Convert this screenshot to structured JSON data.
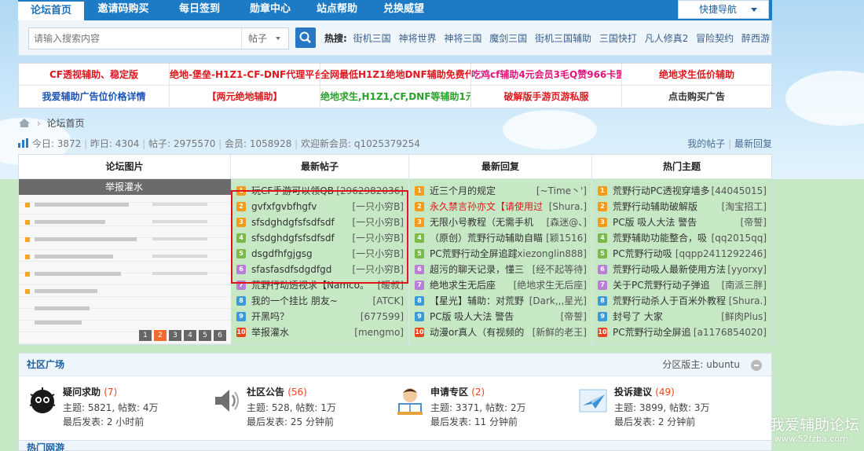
{
  "nav": {
    "items": [
      "论坛首页",
      "邀请码购买",
      "每日签到",
      "勋章中心",
      "站点帮助",
      "兑换威望"
    ],
    "quick_nav": "快捷导航"
  },
  "search": {
    "placeholder": "请输入搜索内容",
    "scope": "帖子",
    "hot_label": "热搜:",
    "hot_terms": [
      "街机三国",
      "神将世界",
      "神将三国",
      "魔剑三国",
      "街机三国辅助",
      "三国快打",
      "凡人修真2",
      "冒险契约",
      "醉西游"
    ]
  },
  "ads": [
    {
      "text": "CF透视辅助、稳定版",
      "color": "#e0161e"
    },
    {
      "text": "绝地-堡垒-H1Z1-CF-DNF代理平台",
      "color": "#e0161e"
    },
    {
      "text": "全网最低H1Z1绝地DNF辅助免费代",
      "color": "#e0161e"
    },
    {
      "text": "吃鸡cf辅助4元会员3毛Q赞966卡盟",
      "color": "#e0167c"
    },
    {
      "text": "绝地求生低价辅助",
      "color": "#e0161e"
    },
    {
      "text": "我爱辅助广告位价格详情",
      "color": "#1a52b8"
    },
    {
      "text": "【两元绝地辅助】",
      "color": "#e0161e"
    },
    {
      "text": "绝地求生,H1Z1,CF,DNF等辅助1元",
      "color": "#2aa12a"
    },
    {
      "text": "破解版手游页游私服",
      "color": "#e0161e"
    },
    {
      "text": "点击购买广告",
      "color": "#333333"
    }
  ],
  "breadcrumb": {
    "home": "论坛首页"
  },
  "stats": {
    "today_label": "今日:",
    "today": "3872",
    "yesterday_label": "昨日:",
    "yesterday": "4304",
    "posts_label": "帖子:",
    "posts": "2975570",
    "members_label": "会员:",
    "members": "1058928",
    "welcome": "欢迎新会员: q1025379254",
    "my_posts": "我的帖子",
    "latest_reply": "最新回复"
  },
  "columns": {
    "pictures": {
      "title": "论坛图片",
      "caption": "举报灌水",
      "pages": [
        "1",
        "2",
        "3",
        "4",
        "5",
        "6"
      ],
      "active_page": "2"
    },
    "new_posts": {
      "title": "最新帖子",
      "rows": [
        {
          "t": "玩CF手游可以领QB",
          "a": "[2962982036]"
        },
        {
          "t": "gvfxfgvbfhgfv",
          "a": "[一只小穷B]"
        },
        {
          "t": "sfsdghdgfsfsdfsdf",
          "a": "[一只小穷B]"
        },
        {
          "t": "sfsdghdgfsfsdfsdf",
          "a": "[一只小穷B]"
        },
        {
          "t": "dsgdfhfgjgsg",
          "a": "[一只小穷B]"
        },
        {
          "t": "sfasfasdfsdgdfgd",
          "a": "[一只小穷B]"
        },
        {
          "t": "荒野行动透视求【Namco。",
          "a": "[暖叔]"
        },
        {
          "t": "我的一个挂比 朋友~",
          "a": "[ATCK]"
        },
        {
          "t": "开黑吗？",
          "a": "[677599]"
        },
        {
          "t": "举报灌水",
          "a": "[mengmo]"
        }
      ]
    },
    "new_replies": {
      "title": "最新回复",
      "rows": [
        {
          "t": "近三个月的规定",
          "a": "[~Time丶']"
        },
        {
          "t": "永久禁言孙亦文【请使用过",
          "a": "[Shura.]",
          "red": true
        },
        {
          "t": "无限小号教程（无需手机",
          "a": "[森迷@、]"
        },
        {
          "t": "（原创）荒野行动辅助自瞄",
          "a": "[颖1516]"
        },
        {
          "t": "PC荒野行动全屏追踪",
          "a": "[xiezonglin888]"
        },
        {
          "t": "超污的聊天记录，懂三",
          "a": "[经不起等待]"
        },
        {
          "t": "绝地求生无后座",
          "a": "[绝地求生无后座]"
        },
        {
          "t": "【星光】辅助：对荒野",
          "a": "[Dark,,,星光]"
        },
        {
          "t": "PC版 吸人大法 警告",
          "a": "[帝誓]"
        },
        {
          "t": "动漫or真人（有视频的",
          "a": "[新鲜的老王]"
        }
      ]
    },
    "hot_topics": {
      "title": "热门主题",
      "rows": [
        {
          "t": "荒野行动PC透视穿墙多",
          "a": "[44045015]"
        },
        {
          "t": "荒野行动辅助破解版",
          "a": "[淘宝招工]"
        },
        {
          "t": "PC版 吸人大法 警告",
          "a": "[帝誓]"
        },
        {
          "t": "荒野辅助功能整合，吸",
          "a": "[qq2015qq]"
        },
        {
          "t": "PC荒野行动吸",
          "a": "[qqpp2411292246]"
        },
        {
          "t": "荒野行动吸人最新使用方法",
          "a": "[yyorxy]"
        },
        {
          "t": "关于PC荒野行动子弹追",
          "a": "[南派三胖]"
        },
        {
          "t": "荒野行动杀人于百米外教程",
          "a": "[Shura.]"
        },
        {
          "t": "封号了 大家",
          "a": "[鲜肉Plus]"
        },
        {
          "t": "PC荒野行动全屏追",
          "a": "[a1176854020]"
        }
      ]
    }
  },
  "rank_colors": [
    "#f59b1b",
    "#f59b1b",
    "#f59b1b",
    "#7ab94a",
    "#7ab94a",
    "#b97fd6",
    "#b97fd6",
    "#3a9ad9",
    "#3a9ad9",
    "#e8461e"
  ],
  "community": {
    "title": "社区广场",
    "moderator": "分区版主: ubuntu",
    "forums": [
      {
        "name": "疑问求助",
        "count": "(7)",
        "stats": "主题: 5821, 帖数: 4万",
        "last": "最后发表: 2 小时前"
      },
      {
        "name": "社区公告",
        "count": "(56)",
        "stats": "主题: 528, 帖数: 1万",
        "last": "最后发表: 25 分钟前"
      },
      {
        "name": "申请专区",
        "count": "(2)",
        "stats": "主题: 3371, 帖数: 2万",
        "last": "最后发表: 11 分钟前"
      },
      {
        "name": "投诉建议",
        "count": "(49)",
        "stats": "主题: 3899, 帖数: 3万",
        "last": "最后发表: 2 分钟前"
      }
    ]
  },
  "hot_network": "热门网游",
  "watermark": {
    "name": "我爱辅助论坛",
    "url": "www.52fzba.com"
  }
}
